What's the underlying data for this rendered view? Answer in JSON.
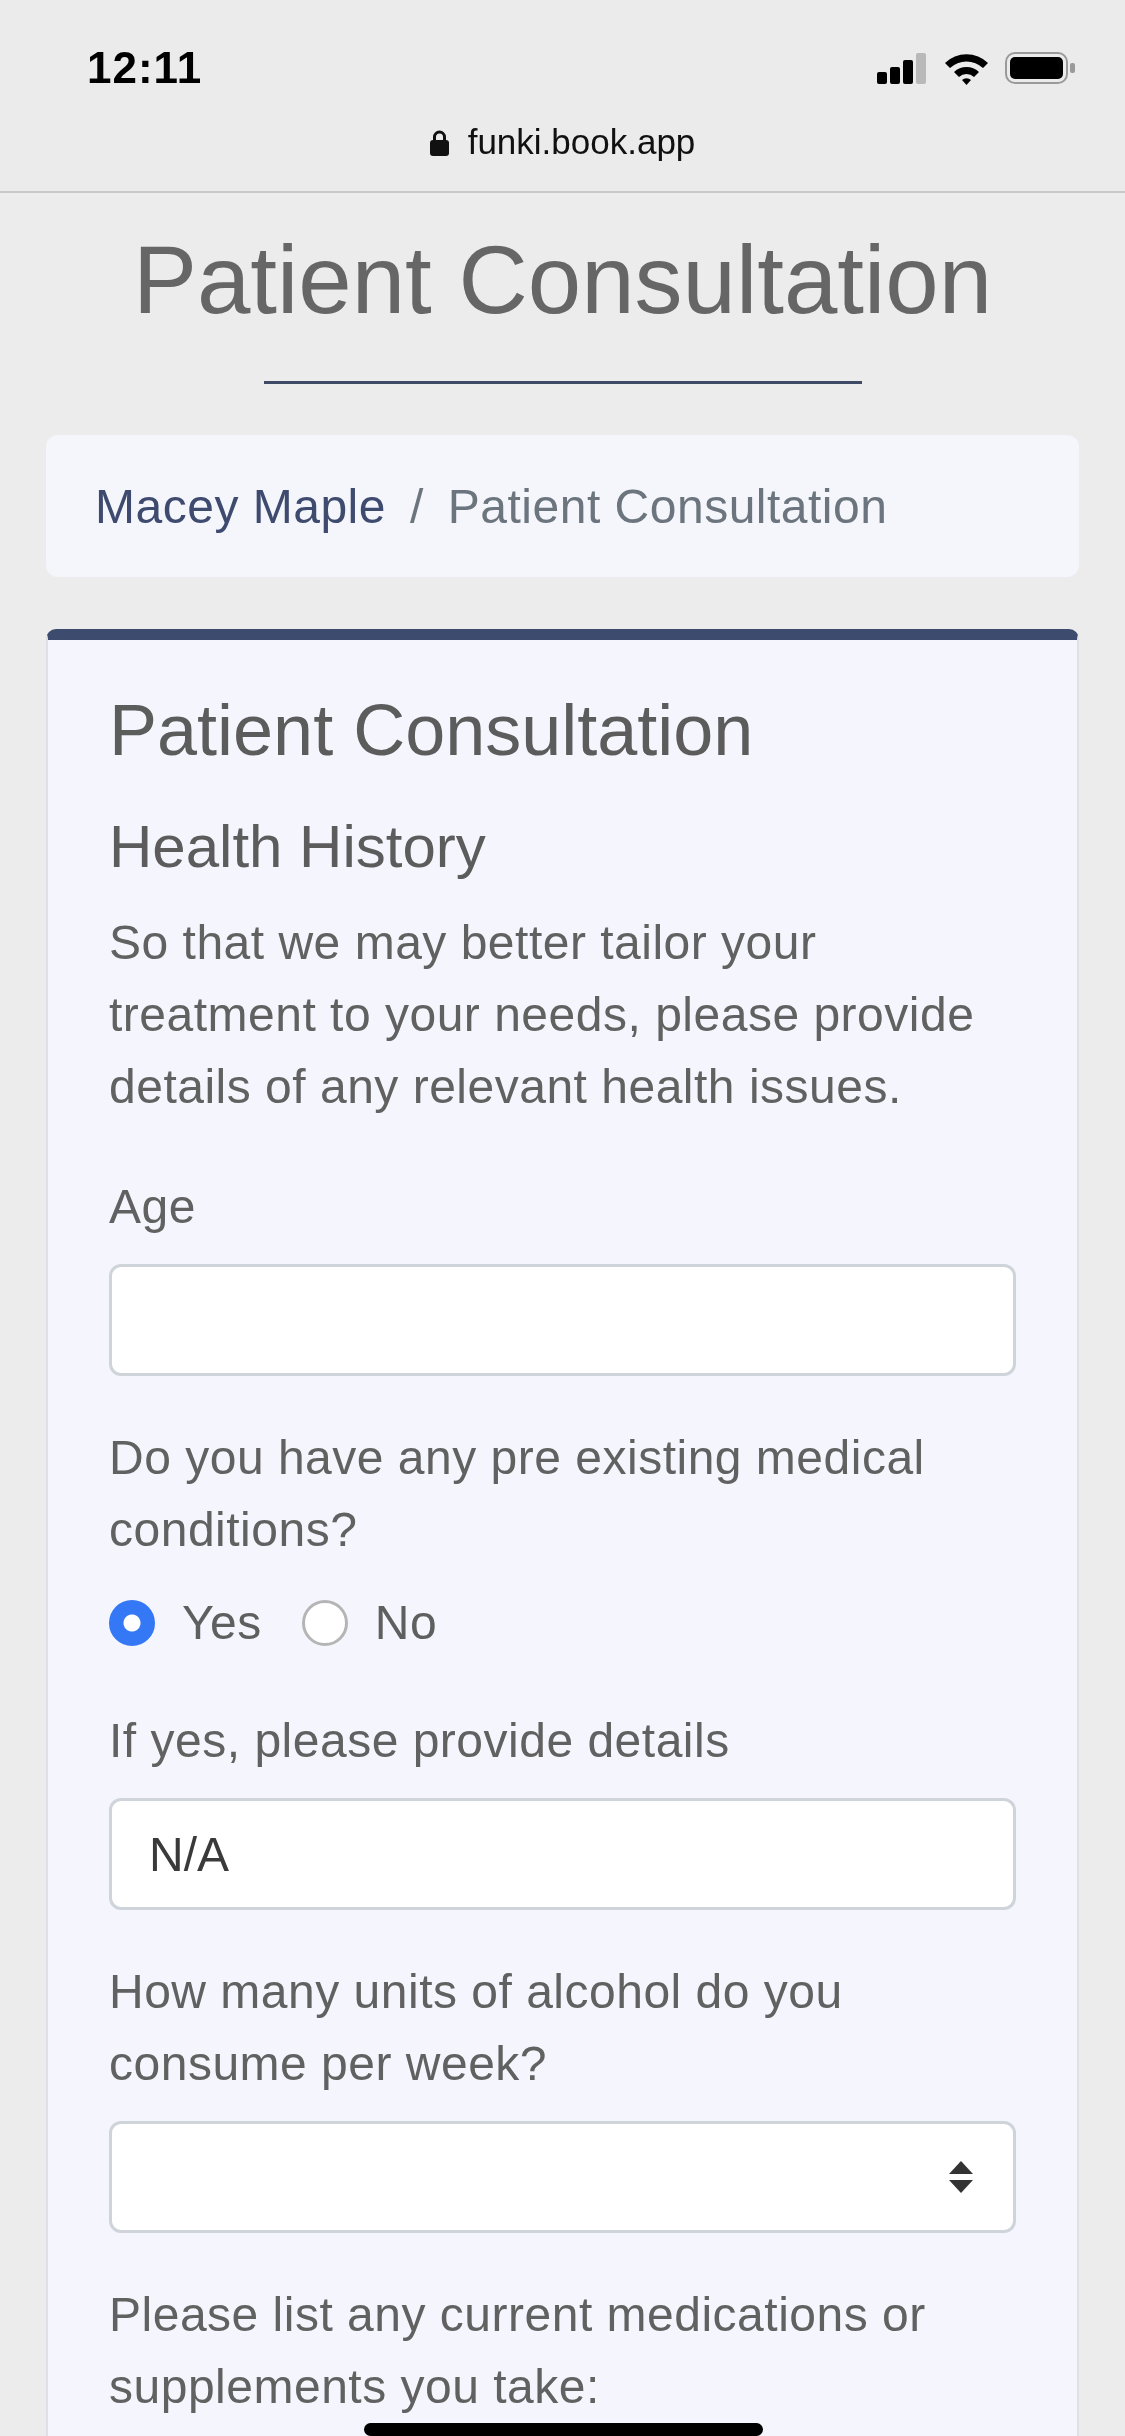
{
  "status_bar": {
    "time": "12:11"
  },
  "browser": {
    "url": "funki.book.app"
  },
  "page": {
    "title": "Patient Consultation"
  },
  "breadcrumb": {
    "separator": "/",
    "items": [
      {
        "label": "Macey Maple",
        "kind": "link"
      },
      {
        "label": "Patient Consultation",
        "kind": "current"
      }
    ]
  },
  "card": {
    "title": "Patient Consultation",
    "section": "Health History",
    "intro": "So that we may better tailor your treatment to your needs, please provide details of any relevant health issues.",
    "fields": [
      {
        "kind": "text",
        "label": "Age"
      },
      {
        "kind": "radio",
        "label": "Do you have any pre existing medical conditions?",
        "options": [
          {
            "label": "Yes",
            "selected": true
          },
          {
            "label": "No",
            "selected": false
          }
        ]
      },
      {
        "kind": "text",
        "label": "If yes, please provide details",
        "value": "N/A"
      },
      {
        "kind": "select",
        "label": "How many units of alcohol do you consume per week?"
      },
      {
        "kind": "question",
        "label": "Please list any current medications or supplements you take:"
      }
    ]
  }
}
